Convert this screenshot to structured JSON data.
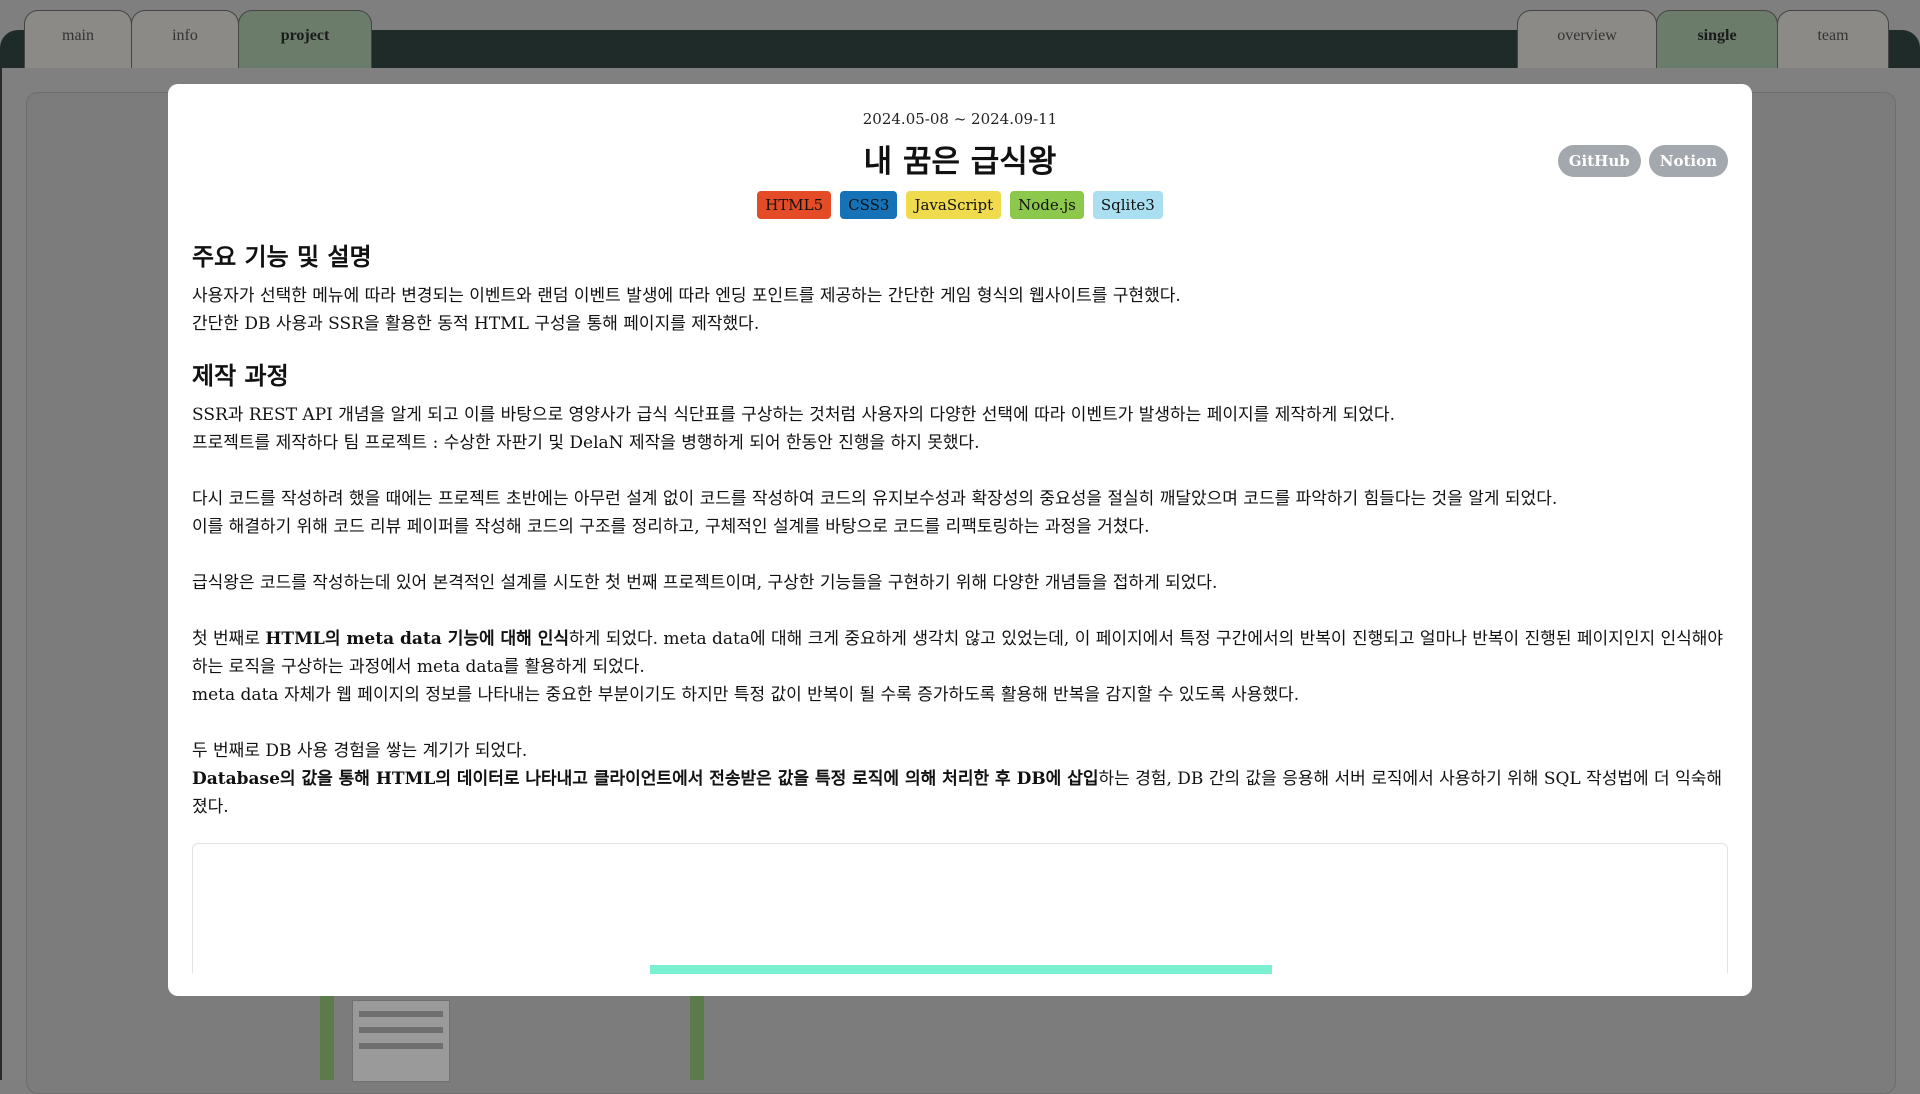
{
  "nav": {
    "left_tabs": [
      {
        "label": "main",
        "active": false
      },
      {
        "label": "info",
        "active": false
      },
      {
        "label": "project",
        "active": true
      }
    ],
    "right_tabs": [
      {
        "label": "overview",
        "active": false
      },
      {
        "label": "single",
        "active": true
      },
      {
        "label": "team",
        "active": false
      }
    ]
  },
  "project": {
    "date": "2024.05-08 ~ 2024.09-11",
    "title": "내 꿈은 급식왕",
    "links": [
      "GitHub",
      "Notion"
    ],
    "tags": [
      {
        "label": "HTML5",
        "bg": "#e34c26",
        "fg": "#111111"
      },
      {
        "label": "CSS3",
        "bg": "#1572b6",
        "fg": "#111111"
      },
      {
        "label": "JavaScript",
        "bg": "#f0db4f",
        "fg": "#111111"
      },
      {
        "label": "Node.js",
        "bg": "#8cc84b",
        "fg": "#111111"
      },
      {
        "label": "Sqlite3",
        "bg": "#a9dff1",
        "fg": "#111111"
      }
    ],
    "section1": {
      "heading": "주요 기능 및 설명",
      "lines": [
        "사용자가 선택한 메뉴에 따라 변경되는 이벤트와 랜덤 이벤트 발생에 따라 엔딩 포인트를 제공하는 간단한 게임 형식의 웹사이트를 구현했다.",
        "간단한 DB 사용과 SSR을 활용한 동적 HTML 구성을 통해 페이지를 제작했다."
      ]
    },
    "section2": {
      "heading": "제작 과정",
      "p1": [
        "SSR과 REST API 개념을 알게 되고 이를 바탕으로 영양사가 급식 식단표를 구상하는 것처럼 사용자의 다양한 선택에 따라 이벤트가 발생하는 페이지를 제작하게 되었다.",
        "프로젝트를 제작하다 팀 프로젝트 : 수상한 자판기 및 DelaN 제작을 병행하게 되어 한동안 진행을 하지 못했다."
      ],
      "p2": [
        "다시 코드를 작성하려 했을 때에는 프로젝트 초반에는 아무런 설계 없이 코드를 작성하여 코드의 유지보수성과 확장성의 중요성을 절실히 깨달았으며 코드를 파악하기 힘들다는 것을 알게 되었다.",
        "이를 해결하기 위해 코드 리뷰 페이퍼를 작성해 코드의 구조를 정리하고, 구체적인 설계를 바탕으로 코드를 리팩토링하는 과정을 거쳤다."
      ],
      "p3": "급식왕은 코드를 작성하는데 있어 본격적인 설계를 시도한 첫 번째 프로젝트이며, 구상한 기능들을 구현하기 위해 다양한 개념들을 접하게 되었다.",
      "p4_prefix": "첫 번째로 ",
      "p4_bold": "HTML의 meta data 기능에 대해 인식",
      "p4_rest": "하게 되었다. meta data에 대해 크게 중요하게 생각치 않고 있었는데, 이 페이지에서 특정 구간에서의 반복이 진행되고 얼마나 반복이 진행된 페이지인지 인식해야 하는 로직을 구상하는 과정에서 meta data를 활용하게 되었다.",
      "p4_line2": "meta data 자체가 웹 페이지의 정보를 나타내는 중요한 부분이기도 하지만 특정 값이 반복이 될 수록 증가하도록 활용해 반복을 감지할 수 있도록 사용했다.",
      "p5_line1": "두 번째로 DB 사용 경험을 쌓는 계기가 되었다.",
      "p5_bold": "Database의 값을 통해 HTML의 데이터로 나타내고 클라이언트에서 전송받은 값을 특정 로직에 의해 처리한 후 DB에 삽입",
      "p5_rest": "하는 경험, DB 간의 값을 응용해 서버 로직에서 사용하기 위해 SQL 작성법에 더 익숙해졌다."
    }
  }
}
